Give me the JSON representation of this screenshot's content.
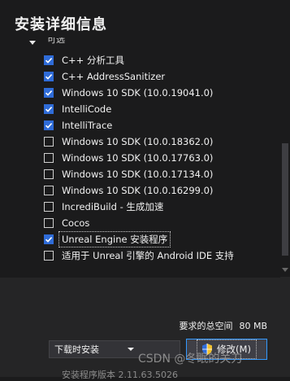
{
  "title": "安装详细信息",
  "section_label": "可选",
  "items": [
    {
      "label": "C++ 分析工具",
      "checked": true
    },
    {
      "label": "C++ AddressSanitizer",
      "checked": true
    },
    {
      "label": "Windows 10 SDK (10.0.19041.0)",
      "checked": true
    },
    {
      "label": "IntelliCode",
      "checked": true
    },
    {
      "label": "IntelliTrace",
      "checked": true
    },
    {
      "label": "Windows 10 SDK (10.0.18362.0)",
      "checked": false
    },
    {
      "label": "Windows 10 SDK (10.0.17763.0)",
      "checked": false
    },
    {
      "label": "Windows 10 SDK (10.0.17134.0)",
      "checked": false
    },
    {
      "label": "Windows 10 SDK (10.0.16299.0)",
      "checked": false
    },
    {
      "label": "IncrediBuild - 生成加速",
      "checked": false
    },
    {
      "label": "Cocos",
      "checked": false
    },
    {
      "label": "Unreal Engine 安装程序",
      "checked": true,
      "focused": true
    },
    {
      "label": "适用于 Unreal 引擎的 Android IDE 支持",
      "checked": false
    }
  ],
  "footer": {
    "space_label": "要求的总空间",
    "space_value": "80 MB",
    "install_mode": "下载时安装",
    "modify_button": "修改(M)",
    "version_text": "安装程序版本 2.11.63.5026"
  },
  "watermark": "CSDN @冬眠的关刀",
  "colors": {
    "accent": "#2f6cd8",
    "focus_border": "#3399ff",
    "background": "#1b1b1c"
  }
}
